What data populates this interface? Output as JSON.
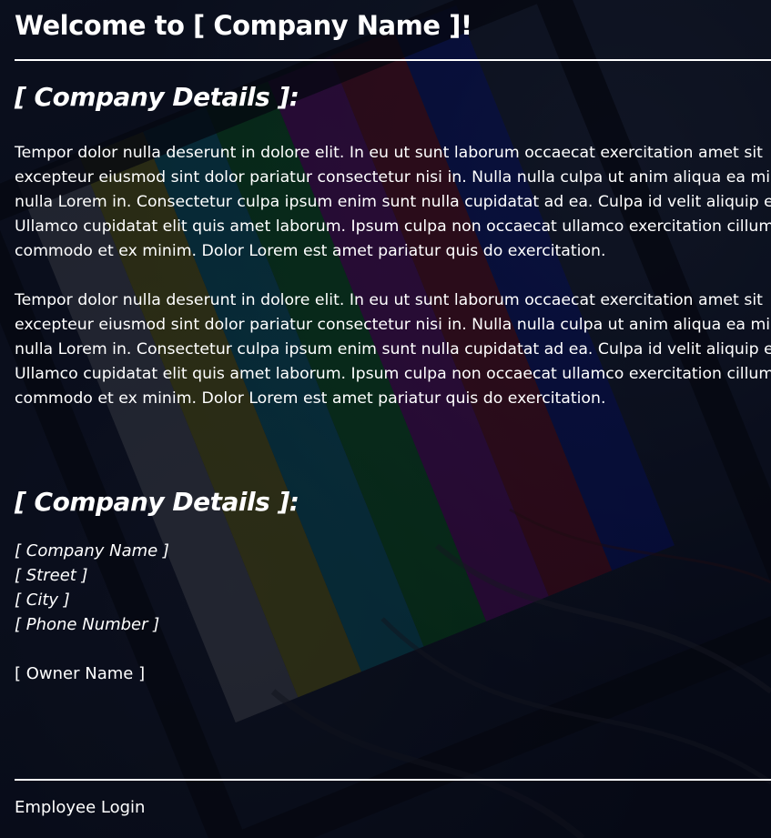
{
  "header": {
    "title": "Welcome to [ Company Name ]!"
  },
  "main": {
    "section_heading_1": "[ Company Details ]:",
    "paragraphs": [
      "Tempor dolor nulla deserunt in dolore elit. In eu ut sunt laborum occaecat exercitation amet sit\nexcepteur eiusmod sint dolor pariatur consectetur nisi in. Nulla nulla culpa ut anim aliqua ea minim\nnulla Lorem in. Consectetur culpa ipsum enim sunt nulla cupidatat ad ea. Culpa id velit aliquip et.\nUllamco cupidatat elit quis amet laborum. Ipsum culpa non occaecat ullamco exercitation cillum\ncommodo et ex minim. Dolor Lorem est amet pariatur quis do exercitation.",
      "Tempor dolor nulla deserunt in dolore elit. In eu ut sunt laborum occaecat exercitation amet sit\nexcepteur eiusmod sint dolor pariatur consectetur nisi in. Nulla nulla culpa ut anim aliqua ea minim\nnulla Lorem in. Consectetur culpa ipsum enim sunt nulla cupidatat ad ea. Culpa id velit aliquip et.\nUllamco cupidatat elit quis amet laborum. Ipsum culpa non occaecat ullamco exercitation cillum\ncommodo et ex minim. Dolor Lorem est amet pariatur quis do exercitation."
    ],
    "section_heading_2": "[ Company Details ]:",
    "details": {
      "company_name": "[ Company Name ]",
      "street": "[ Street ]",
      "city": "[ City ]",
      "phone": "[ Phone Number ]",
      "owner": "[ Owner Name ]"
    }
  },
  "footer": {
    "employee_login": "Employee Login"
  },
  "colors": {
    "text": "#ffffff",
    "background": "#0a0f1e",
    "rule": "#ffffff"
  }
}
